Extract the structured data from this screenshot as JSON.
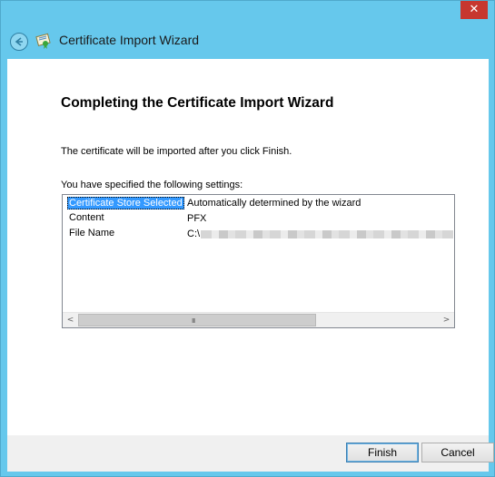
{
  "window": {
    "title": "Certificate Import Wizard",
    "close_glyph": "✕",
    "accent_color": "#66c8ec"
  },
  "heading": "Completing the Certificate Import Wizard",
  "description": "The certificate will be imported after you click Finish.",
  "settings_label": "You have specified the following settings:",
  "settings": [
    {
      "key": "Certificate Store Selected",
      "value": "Automatically determined by the wizard"
    },
    {
      "key": "Content",
      "value": "PFX"
    },
    {
      "key": "File Name",
      "value": "C:\\"
    }
  ],
  "scrollbar": {
    "left_glyph": "<",
    "right_glyph": ">",
    "grip_glyph": "III"
  },
  "buttons": {
    "finish": "Finish",
    "cancel": "Cancel"
  },
  "icons": {
    "back": "back-arrow-icon",
    "cert": "certificate-icon"
  }
}
